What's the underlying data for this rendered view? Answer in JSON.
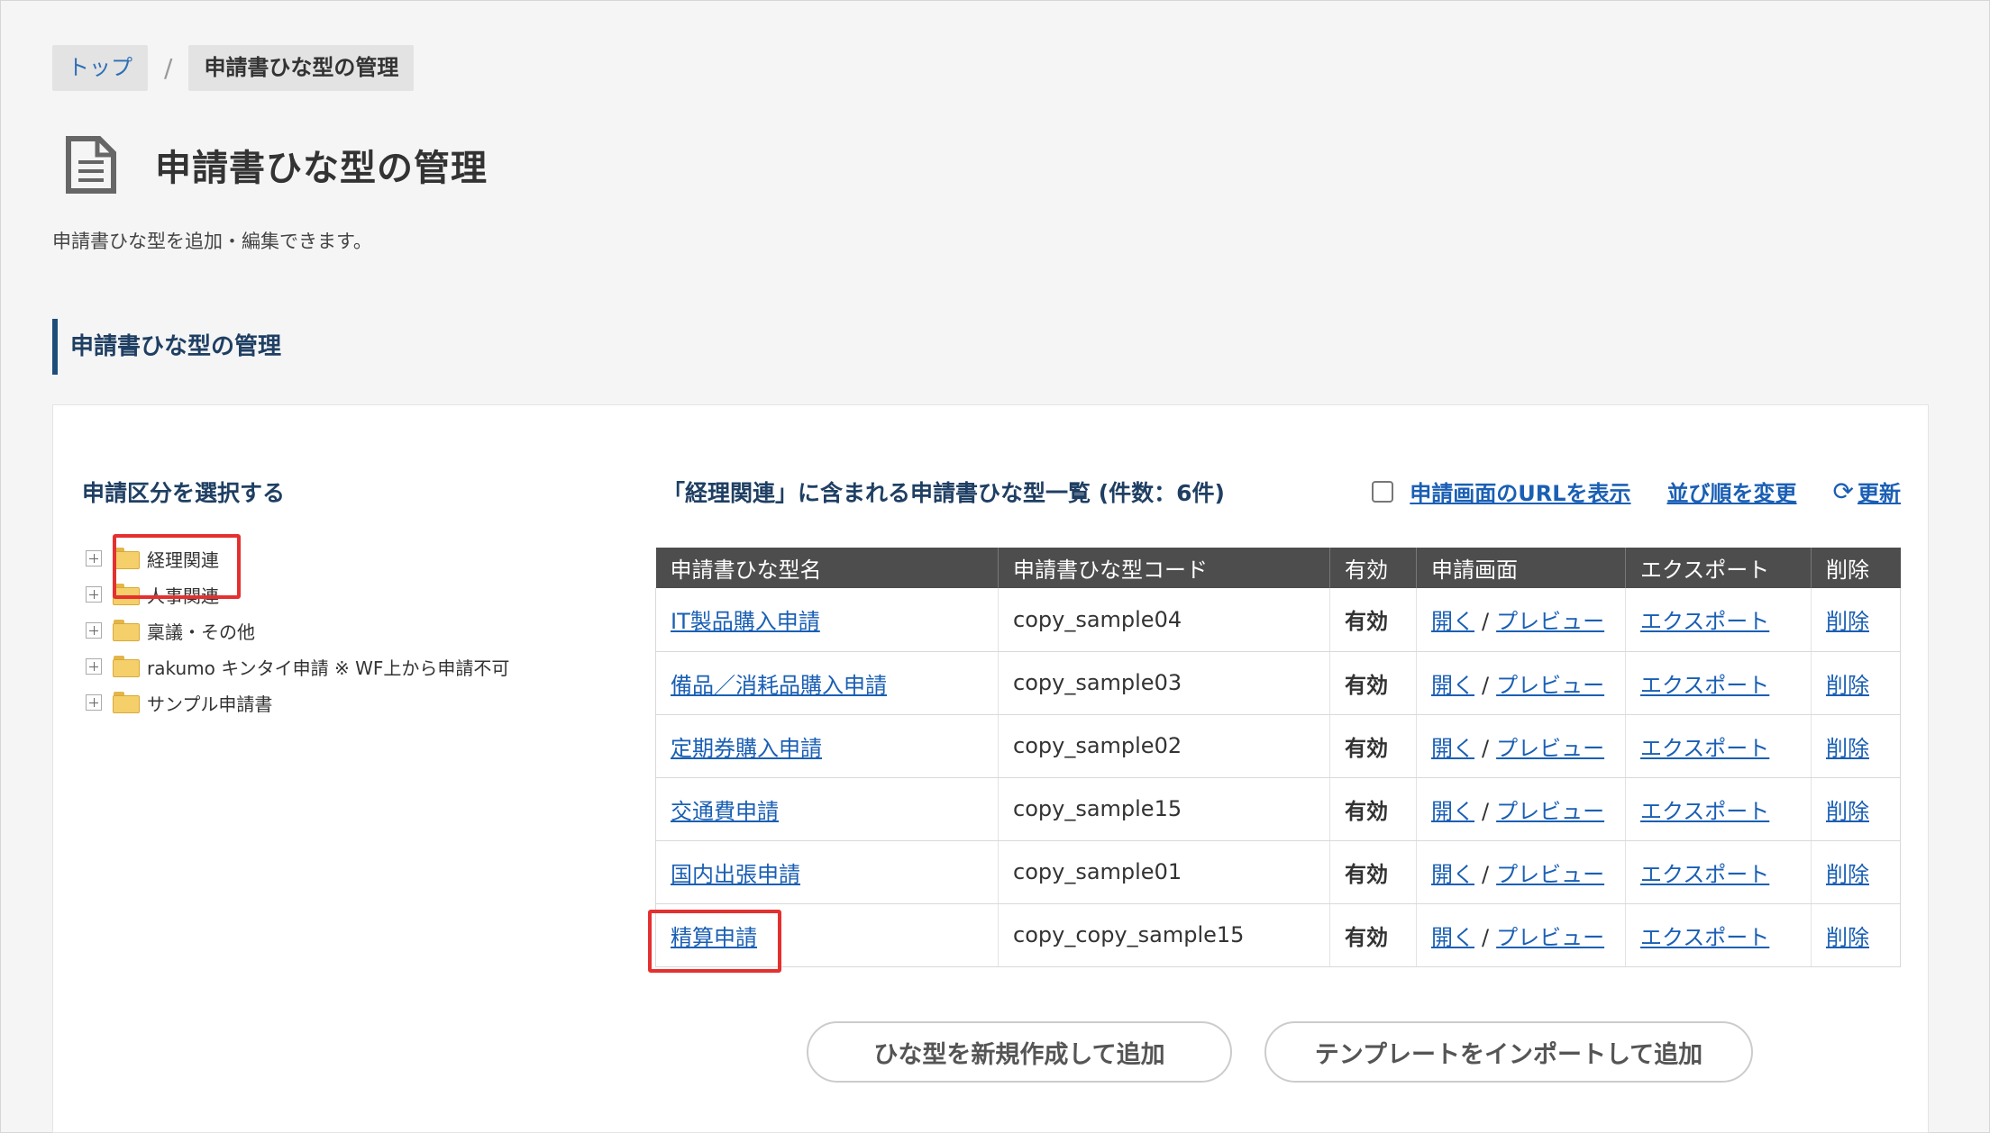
{
  "breadcrumb": {
    "items": [
      {
        "label": "トップ"
      },
      {
        "label": "申請書ひな型の管理"
      }
    ],
    "separator": "/"
  },
  "page": {
    "title": "申請書ひな型の管理",
    "description": "申請書ひな型を追加・編集できます。",
    "icon": "document-icon"
  },
  "section": {
    "title": "申請書ひな型の管理"
  },
  "left_panel": {
    "title": "申請区分を選択する",
    "tree": [
      {
        "label": "経理関連",
        "selected": true
      },
      {
        "label": "人事関連"
      },
      {
        "label": "稟議・その他"
      },
      {
        "label": "rakumo キンタイ申請 ※ WF上から申請不可"
      },
      {
        "label": "サンプル申請書"
      }
    ]
  },
  "list": {
    "title": "「経理関連」に含まれる申請書ひな型一覧 (件数：6件)",
    "tools": {
      "show_url_label": "申請画面のURLを表示",
      "reorder_label": "並び順を変更",
      "refresh_label": "更新"
    },
    "columns": [
      "申請書ひな型名",
      "申請書ひな型コード",
      "有効",
      "申請画面",
      "エクスポート",
      "削除"
    ],
    "open_label": "開く",
    "preview_label": "プレビュー",
    "export_label": "エクスポート",
    "delete_label": "削除",
    "rows": [
      {
        "name": "IT製品購入申請",
        "code": "copy_sample04",
        "status": "有効"
      },
      {
        "name": "備品／消耗品購入申請",
        "code": "copy_sample03",
        "status": "有効"
      },
      {
        "name": "定期券購入申請",
        "code": "copy_sample02",
        "status": "有効"
      },
      {
        "name": "交通費申請",
        "code": "copy_sample15",
        "status": "有効"
      },
      {
        "name": "国内出張申請",
        "code": "copy_sample01",
        "status": "有効"
      },
      {
        "name": "精算申請",
        "code": "copy_copy_sample15",
        "status": "有効"
      }
    ]
  },
  "buttons": {
    "create_new": "ひな型を新規作成して追加",
    "import_template": "テンプレートをインポートして追加"
  },
  "colors": {
    "link": "#1a5fb4",
    "valid": "#1b8a3a",
    "highlight": "#e53030",
    "header_bg": "#4d4d4d"
  }
}
